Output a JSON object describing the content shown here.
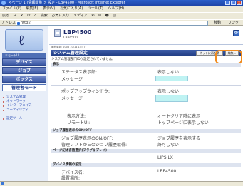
{
  "browser": {
    "title": "<ページ 1 (情報閲覧)> 設定 - LBP4500 - Microsoft Internet Explorer",
    "menu": [
      "ファイル(F)",
      "編集(E)",
      "表示(V)",
      "お気に入り(A)",
      "ツール(T)",
      "ヘルプ(H)"
    ],
    "toolbar": [
      "戻る",
      "→",
      "×",
      "⟳",
      "⌂",
      "検索",
      "お気に入り",
      "メディア",
      "⟲",
      "✉",
      "🖶",
      "▤"
    ],
    "address_label": "アドレス(D)",
    "address_value": "http://",
    "go_label": "移動",
    "links_label": "リンク"
  },
  "sidebar": {
    "logo_char": "ℓ",
    "nav_title": "リモートUI",
    "nav": [
      "デバイス",
      "ジョブ",
      "ボックス",
      "管理者モード"
    ],
    "sub_links": [
      "システム管理",
      "ネットワーク",
      "インターフェイス",
      "ユーティリティ"
    ],
    "bottom_link": "設定ツール"
  },
  "header": {
    "model": "LBP4500",
    "model_sub": "LBP4500"
  },
  "page": {
    "breadcrumb": "最終更新: 2006 10/14 14:57",
    "title": "システム管理設定",
    "btn_refresh": "ネットに再起動",
    "btn_edit": "編集...",
    "note": "システム管理部門IDが設定されていません。"
  },
  "sections": {
    "s1": "表示",
    "s1_rows": [
      {
        "k": "ステータス表示部:",
        "v": "表示しない"
      },
      {
        "k": "メッセージ",
        "v": ""
      },
      {
        "k": "ポップアップウィンドウ:",
        "v": "表示しない"
      },
      {
        "k": "メッセージ",
        "v": ""
      },
      {
        "k": "表示方法:",
        "v": "オートクリア時に表示"
      },
      {
        "k": "リモートUI:",
        "v": "トップページに表示しない"
      }
    ],
    "s2": "ジョブ履歴表示のON/OFF",
    "s2_rows": [
      {
        "k": "ジョブ履歴表示のON/OFF:",
        "v": "ジョブ履歴を表示する"
      },
      {
        "k": "管理ソフトからのジョブ履歴取得:",
        "v": "許可しない"
      }
    ],
    "s3": "ページ記述言語選択(プラグ＆プレイ)",
    "s3_value": "LIPS LX",
    "s4": "デバイス情報の設定",
    "s4_rows": [
      {
        "k": "デバイス名:",
        "v": "LBP4500"
      },
      {
        "k": "設置場所:",
        "v": ""
      }
    ]
  },
  "colors": {
    "accent": "#f08a1c",
    "nav": "#3c59a6",
    "field": "#bff3f3"
  }
}
